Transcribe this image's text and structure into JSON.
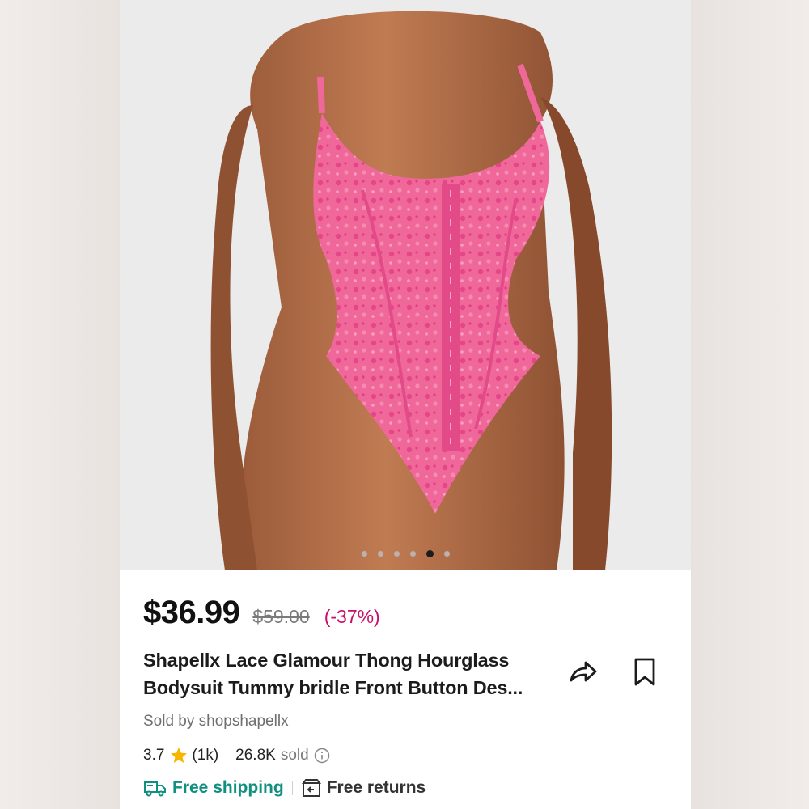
{
  "product": {
    "price": "$36.99",
    "original_price": "$59.00",
    "discount": "(-37%)",
    "title_line1": "Shapellx Lace Glamour Thong Hourglass",
    "title_line2": "Bodysuit Tummy bridle Front Button Des...",
    "seller": "Sold by shopshapellx",
    "rating": "3.7",
    "review_count": "(1k)",
    "sold_count": "26.8K",
    "sold_label": "sold"
  },
  "gallery": {
    "image_count": 6,
    "active_index": 4
  },
  "badges": {
    "shipping": "Free shipping",
    "returns": "Free returns"
  },
  "icons": {
    "share": "share-icon",
    "bookmark": "bookmark-icon",
    "star": "star-icon",
    "info": "info-icon",
    "truck": "truck-icon",
    "returns": "return-box-icon"
  },
  "colors": {
    "discount": "#c8106a",
    "shipping": "#0f8f7f",
    "product_pink": "#f0679a",
    "star": "#f7b500"
  }
}
